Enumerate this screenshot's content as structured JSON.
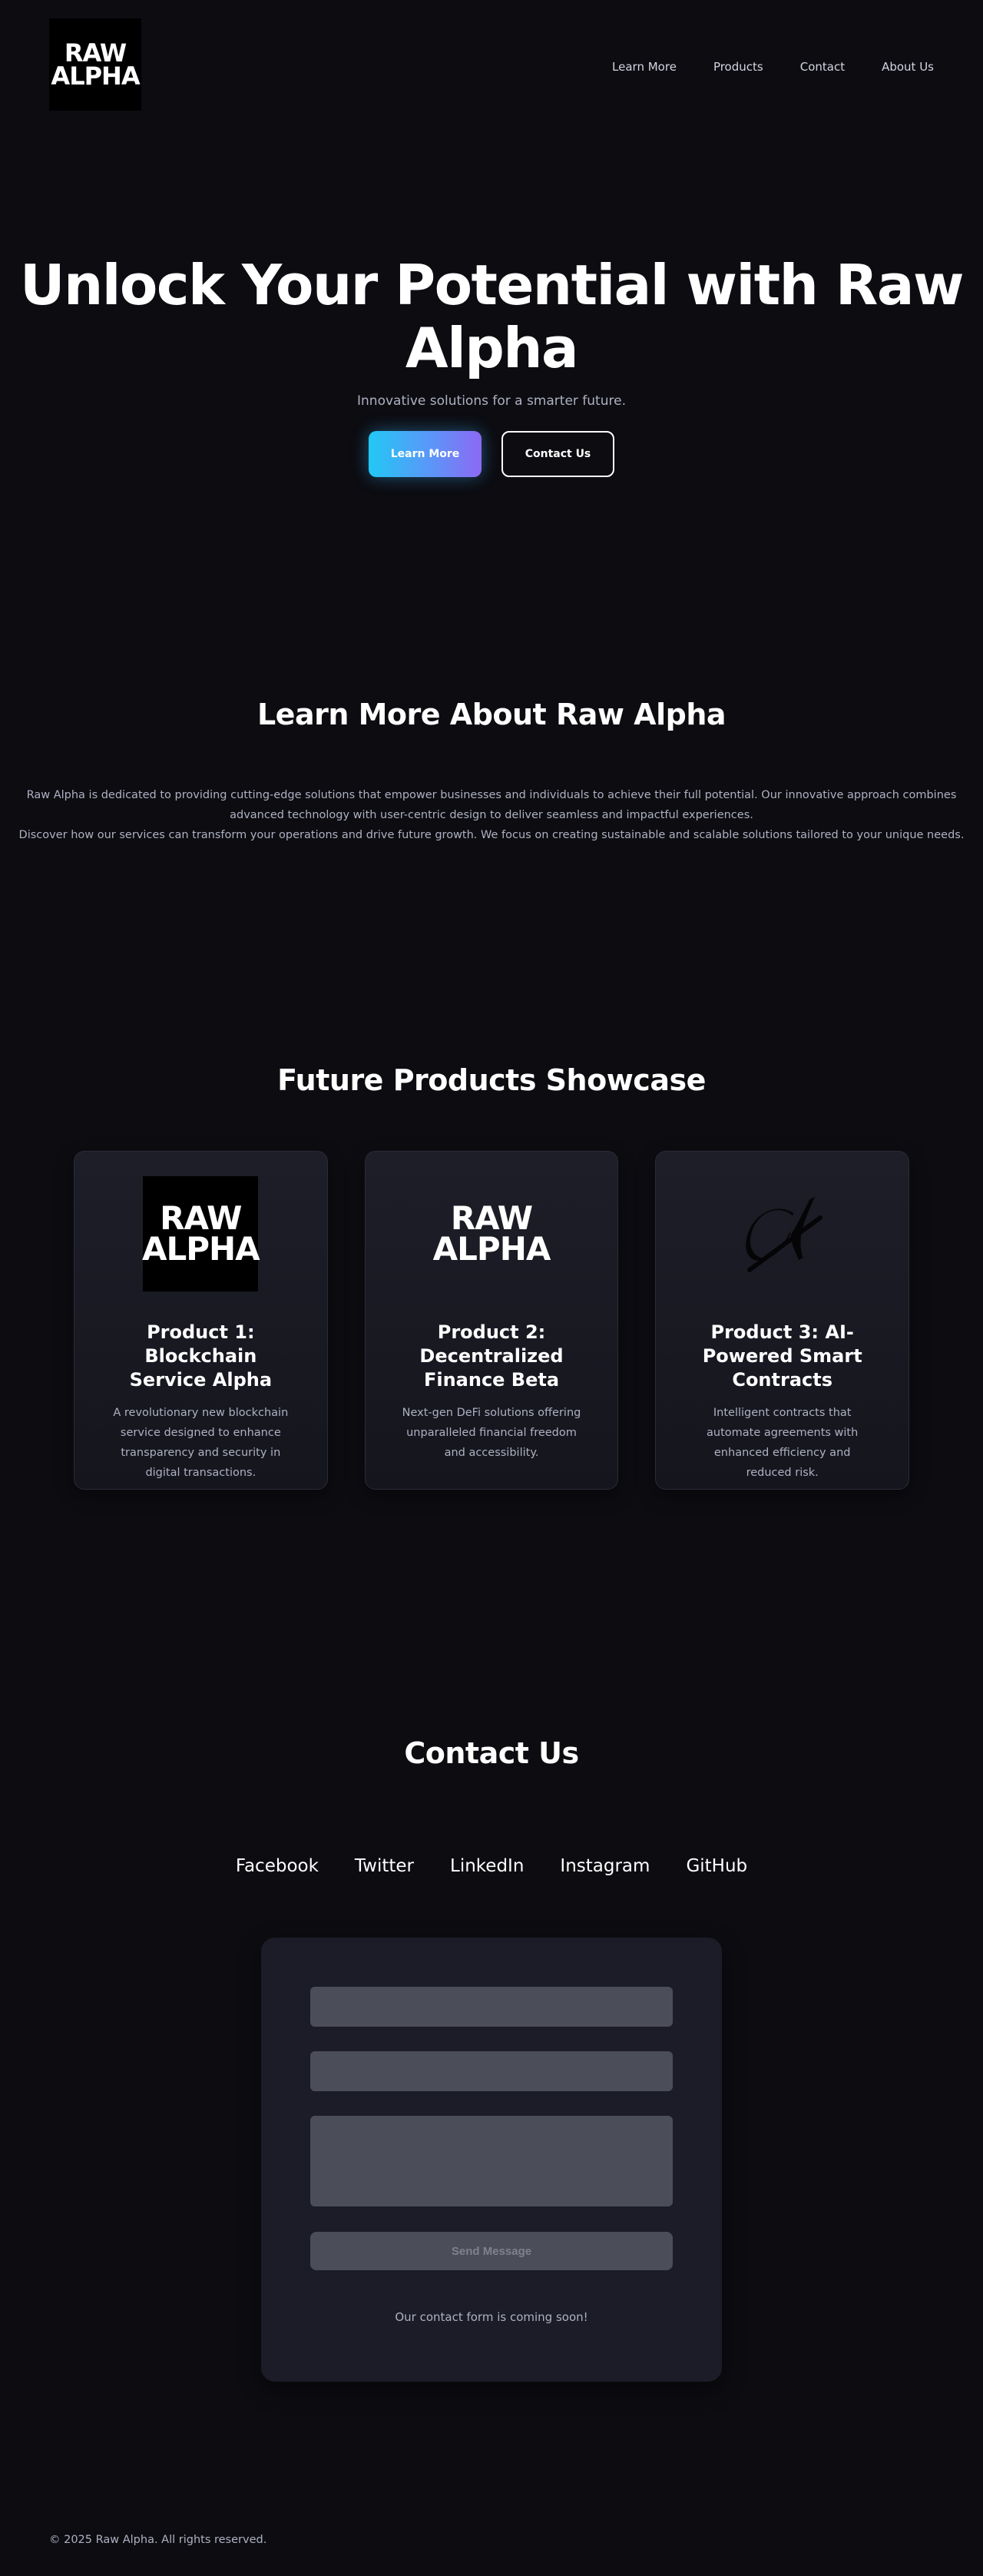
{
  "brand": {
    "logo_line1": "RAW",
    "logo_line2": "ALPHA"
  },
  "nav": {
    "items": [
      "Learn More",
      "Products",
      "Contact",
      "About Us"
    ]
  },
  "hero": {
    "title_line1": "Unlock Your Potential with Raw",
    "title_line2": "Alpha",
    "subtitle": "Innovative solutions for a smarter future.",
    "primary_button": "Learn More",
    "secondary_button": "Contact Us"
  },
  "about": {
    "title": "Learn More About Raw Alpha",
    "line1": "Raw Alpha is dedicated to providing cutting-edge solutions that empower businesses and individuals to achieve their full potential. Our innovative approach combines",
    "line2": "advanced technology with user-centric design to deliver seamless and impactful experiences.",
    "line3": "Discover how our services can transform your operations and drive future growth. We focus on creating sustainable and scalable solutions tailored to your unique needs."
  },
  "products": {
    "title": "Future Products Showcase",
    "items": [
      {
        "title": "Product 1: Blockchain Service Alpha",
        "description": "A revolutionary new blockchain service designed to enhance transparency and security in digital transactions.",
        "image_type": "raw-alpha-logo-black"
      },
      {
        "title": "Product 2: Decentralized Finance Beta",
        "description": "Next-gen DeFi solutions offering unparalleled financial freedom and accessibility.",
        "image_type": "raw-alpha-logo-transparent"
      },
      {
        "title": "Product 3: AI-Powered Smart Contracts",
        "description": "Intelligent contracts that automate agreements with enhanced efficiency and reduced risk.",
        "image_type": "alpha-symbol-icon"
      }
    ]
  },
  "contact": {
    "title": "Contact Us",
    "social": [
      "Facebook",
      "Twitter",
      "LinkedIn",
      "Instagram",
      "GitHub"
    ],
    "send_button": "Send Message",
    "note": "Our contact form is coming soon!"
  },
  "footer": {
    "copyright": "© 2025 Raw Alpha. All rights reserved."
  },
  "colors": {
    "background": "#0c0c11",
    "card": "#1c1c28",
    "field": "#4b4d58",
    "muted_text": "#aeb1c2",
    "gradient_start": "#22c8f5",
    "gradient_end": "#8c69f4"
  }
}
